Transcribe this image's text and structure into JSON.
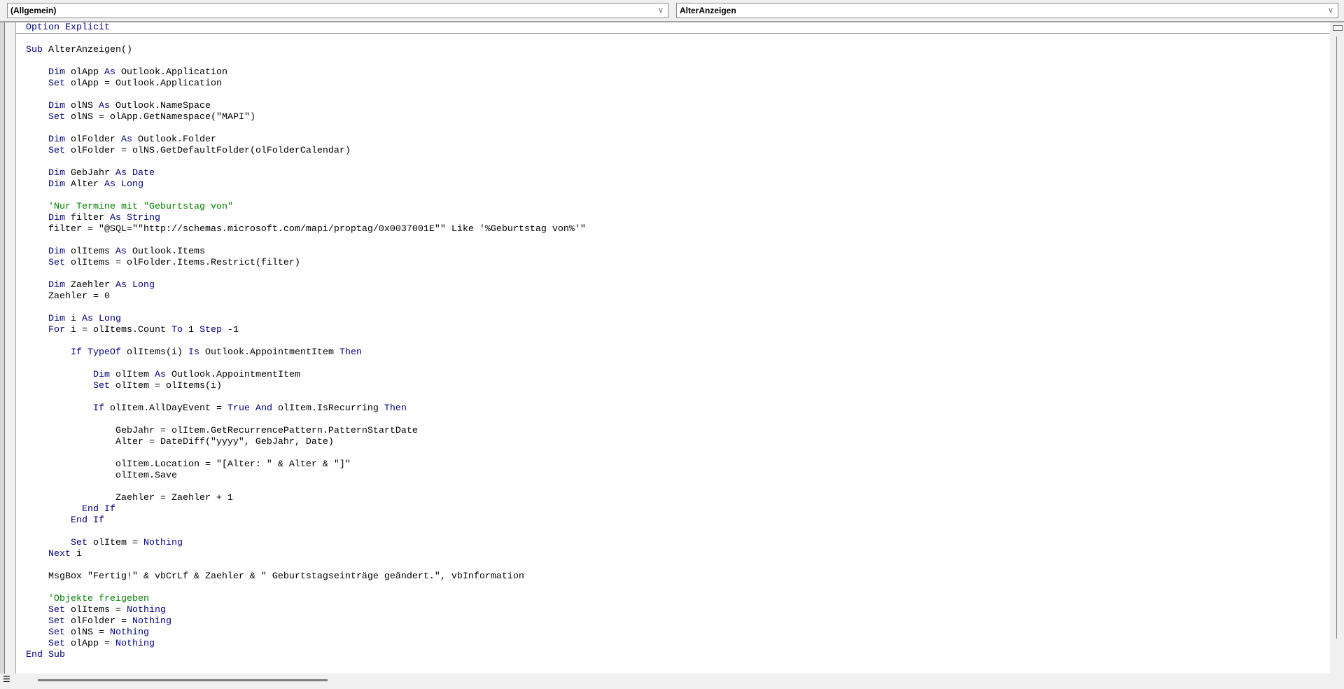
{
  "header": {
    "object_combo": "(Allgemein)",
    "procedure_combo": "AlterAnzeigen"
  },
  "colors": {
    "keyword": "#00007f",
    "comment": "#008000",
    "text": "#000000"
  },
  "code_lines": [
    [
      [
        "k",
        "Option Explicit"
      ]
    ],
    [],
    [
      [
        "k",
        "Sub"
      ],
      [
        "t",
        " AlterAnzeigen()"
      ]
    ],
    [],
    [
      [
        "t",
        "    "
      ],
      [
        "k",
        "Dim"
      ],
      [
        "t",
        " olApp "
      ],
      [
        "k",
        "As"
      ],
      [
        "t",
        " Outlook.Application"
      ]
    ],
    [
      [
        "t",
        "    "
      ],
      [
        "k",
        "Set"
      ],
      [
        "t",
        " olApp = Outlook.Application"
      ]
    ],
    [],
    [
      [
        "t",
        "    "
      ],
      [
        "k",
        "Dim"
      ],
      [
        "t",
        " olNS "
      ],
      [
        "k",
        "As"
      ],
      [
        "t",
        " Outlook.NameSpace"
      ]
    ],
    [
      [
        "t",
        "    "
      ],
      [
        "k",
        "Set"
      ],
      [
        "t",
        " olNS = olApp.GetNamespace(\"MAPI\")"
      ]
    ],
    [],
    [
      [
        "t",
        "    "
      ],
      [
        "k",
        "Dim"
      ],
      [
        "t",
        " olFolder "
      ],
      [
        "k",
        "As"
      ],
      [
        "t",
        " Outlook.Folder"
      ]
    ],
    [
      [
        "t",
        "    "
      ],
      [
        "k",
        "Set"
      ],
      [
        "t",
        " olFolder = olNS.GetDefaultFolder(olFolderCalendar)"
      ]
    ],
    [],
    [
      [
        "t",
        "    "
      ],
      [
        "k",
        "Dim"
      ],
      [
        "t",
        " GebJahr "
      ],
      [
        "k",
        "As"
      ],
      [
        "t",
        " "
      ],
      [
        "k",
        "Date"
      ]
    ],
    [
      [
        "t",
        "    "
      ],
      [
        "k",
        "Dim"
      ],
      [
        "t",
        " Alter "
      ],
      [
        "k",
        "As"
      ],
      [
        "t",
        " "
      ],
      [
        "k",
        "Long"
      ]
    ],
    [],
    [
      [
        "t",
        "    "
      ],
      [
        "c",
        "'Nur Termine mit \"Geburtstag von\""
      ]
    ],
    [
      [
        "t",
        "    "
      ],
      [
        "k",
        "Dim"
      ],
      [
        "t",
        " filter "
      ],
      [
        "k",
        "As"
      ],
      [
        "t",
        " "
      ],
      [
        "k",
        "String"
      ]
    ],
    [
      [
        "t",
        "    filter = \"@SQL=\"\"http://schemas.microsoft.com/mapi/proptag/0x0037001E\"\" Like '%Geburtstag von%'\""
      ]
    ],
    [],
    [
      [
        "t",
        "    "
      ],
      [
        "k",
        "Dim"
      ],
      [
        "t",
        " olItems "
      ],
      [
        "k",
        "As"
      ],
      [
        "t",
        " Outlook.Items"
      ]
    ],
    [
      [
        "t",
        "    "
      ],
      [
        "k",
        "Set"
      ],
      [
        "t",
        " olItems = olFolder.Items.Restrict(filter)"
      ]
    ],
    [],
    [
      [
        "t",
        "    "
      ],
      [
        "k",
        "Dim"
      ],
      [
        "t",
        " Zaehler "
      ],
      [
        "k",
        "As"
      ],
      [
        "t",
        " "
      ],
      [
        "k",
        "Long"
      ]
    ],
    [
      [
        "t",
        "    Zaehler = 0"
      ]
    ],
    [],
    [
      [
        "t",
        "    "
      ],
      [
        "k",
        "Dim"
      ],
      [
        "t",
        " i "
      ],
      [
        "k",
        "As"
      ],
      [
        "t",
        " "
      ],
      [
        "k",
        "Long"
      ]
    ],
    [
      [
        "t",
        "    "
      ],
      [
        "k",
        "For"
      ],
      [
        "t",
        " i = olItems.Count "
      ],
      [
        "k",
        "To"
      ],
      [
        "t",
        " 1 "
      ],
      [
        "k",
        "Step"
      ],
      [
        "t",
        " -1"
      ]
    ],
    [],
    [
      [
        "t",
        "        "
      ],
      [
        "k",
        "If"
      ],
      [
        "t",
        " "
      ],
      [
        "k",
        "TypeOf"
      ],
      [
        "t",
        " olItems(i) "
      ],
      [
        "k",
        "Is"
      ],
      [
        "t",
        " Outlook.AppointmentItem "
      ],
      [
        "k",
        "Then"
      ]
    ],
    [],
    [
      [
        "t",
        "            "
      ],
      [
        "k",
        "Dim"
      ],
      [
        "t",
        " olItem "
      ],
      [
        "k",
        "As"
      ],
      [
        "t",
        " Outlook.AppointmentItem"
      ]
    ],
    [
      [
        "t",
        "            "
      ],
      [
        "k",
        "Set"
      ],
      [
        "t",
        " olItem = olItems(i)"
      ]
    ],
    [],
    [
      [
        "t",
        "            "
      ],
      [
        "k",
        "If"
      ],
      [
        "t",
        " olItem.AllDayEvent = "
      ],
      [
        "k",
        "True"
      ],
      [
        "t",
        " "
      ],
      [
        "k",
        "And"
      ],
      [
        "t",
        " olItem.IsRecurring "
      ],
      [
        "k",
        "Then"
      ]
    ],
    [],
    [
      [
        "t",
        "                GebJahr = olItem.GetRecurrencePattern.PatternStartDate"
      ]
    ],
    [
      [
        "t",
        "                Alter = DateDiff(\"yyyy\", GebJahr, Date)"
      ]
    ],
    [],
    [
      [
        "t",
        "                olItem.Location = \"[Alter: \" & Alter & \"]\""
      ]
    ],
    [
      [
        "t",
        "                olItem.Save"
      ]
    ],
    [],
    [
      [
        "t",
        "                Zaehler = Zaehler + 1"
      ]
    ],
    [
      [
        "t",
        "          "
      ],
      [
        "k",
        "End If"
      ]
    ],
    [
      [
        "t",
        "        "
      ],
      [
        "k",
        "End If"
      ]
    ],
    [],
    [
      [
        "t",
        "        "
      ],
      [
        "k",
        "Set"
      ],
      [
        "t",
        " olItem = "
      ],
      [
        "k",
        "Nothing"
      ]
    ],
    [
      [
        "t",
        "    "
      ],
      [
        "k",
        "Next"
      ],
      [
        "t",
        " i"
      ]
    ],
    [],
    [
      [
        "t",
        "    MsgBox \"Fertig!\" & vbCrLf & Zaehler & \" Geburtstagseinträge geändert.\", vbInformation"
      ]
    ],
    [],
    [
      [
        "t",
        "    "
      ],
      [
        "c",
        "'Objekte freigeben"
      ]
    ],
    [
      [
        "t",
        "    "
      ],
      [
        "k",
        "Set"
      ],
      [
        "t",
        " olItems = "
      ],
      [
        "k",
        "Nothing"
      ]
    ],
    [
      [
        "t",
        "    "
      ],
      [
        "k",
        "Set"
      ],
      [
        "t",
        " olFolder = "
      ],
      [
        "k",
        "Nothing"
      ]
    ],
    [
      [
        "t",
        "    "
      ],
      [
        "k",
        "Set"
      ],
      [
        "t",
        " olNS = "
      ],
      [
        "k",
        "Nothing"
      ]
    ],
    [
      [
        "t",
        "    "
      ],
      [
        "k",
        "Set"
      ],
      [
        "t",
        " olApp = "
      ],
      [
        "k",
        "Nothing"
      ]
    ],
    [
      [
        "k",
        "End Sub"
      ]
    ]
  ]
}
